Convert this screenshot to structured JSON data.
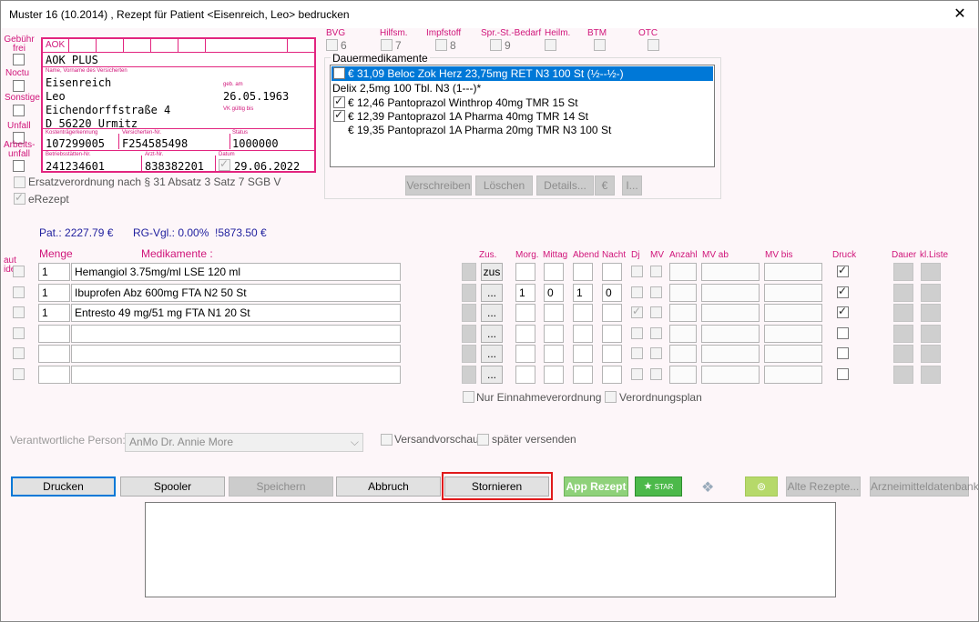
{
  "window": {
    "title": "Muster 16 (10.2014) , Rezept für Patient <Eisenreich, Leo> bedrucken"
  },
  "flags": {
    "gebuehr": "Gebühr frei",
    "noctu": "Noctu",
    "sonstige": "Sonstige",
    "unfall": "Unfall",
    "arbeitsunfall": "Arbeits-unfall",
    "aut_idem": "aut idem"
  },
  "form": {
    "kasse": "AOK",
    "kasse_name": "AOK PLUS",
    "label_name": "Name, Vorname des Versicherten",
    "lastname": "Eisenreich",
    "firstname": "Leo",
    "street": "Eichendorffstraße 4",
    "city": "D 56220 Urmitz",
    "label_geb": "geb. am",
    "birthdate": "26.05.1963",
    "label_vk": "VK gültig bis",
    "label_kt": "Kostenträgerkennung",
    "kt": "107299005",
    "label_vers": "Versicherten-Nr.",
    "vers": "F254585498",
    "label_status": "Status",
    "status": "1000000",
    "label_bs": "Betriebsstätten-Nr.",
    "bs": "241234601",
    "label_arzt": "Arzt-Nr.",
    "arzt": "838382201",
    "label_datum": "Datum",
    "datum": "29.06.2022"
  },
  "categories": [
    {
      "label": "BVG",
      "num": "6"
    },
    {
      "label": "Hilfsm.",
      "num": "7"
    },
    {
      "label": "Impfstoff",
      "num": "8"
    },
    {
      "label": "Spr.-St.-Bedarf",
      "num": "9"
    },
    {
      "label": "Heilm.",
      "num": ""
    },
    {
      "label": "BTM",
      "num": ""
    },
    {
      "label": "OTC",
      "num": ""
    }
  ],
  "ersatz": "Ersatzverordnung nach § 31 Absatz 3 Satz 7 SGB V",
  "erezept": "eRezept",
  "dauer": {
    "title": "Dauermedikamente",
    "items": [
      {
        "text": "€ 31,09   Beloc Zok Herz 23,75mg RET N3 100 St (½--½-)",
        "checked": false,
        "selected": true
      },
      {
        "text": "Delix 2,5mg 100 Tbl.  N3 (1---)*",
        "checked": false,
        "selected": false
      },
      {
        "text": "€ 12,46  Pantoprazol Winthrop 40mg TMR 15 St",
        "checked": true,
        "selected": false
      },
      {
        "text": "€ 12,39  Pantoprazol 1A Pharma 40mg TMR 14 St",
        "checked": true,
        "selected": false
      },
      {
        "text": "€ 19,35   Pantoprazol 1A Pharma 20mg TMR N3 100 St",
        "checked": false,
        "selected": false
      }
    ],
    "buttons": {
      "verschreiben": "Verschreiben",
      "loeschen": "Löschen",
      "details": "Details...",
      "euro": "€",
      "i": "I..."
    }
  },
  "summary": {
    "pat": "Pat.:  2227.79 €",
    "rg": "RG-Vgl.:  0.00%",
    "rg2": "!5873.50 €"
  },
  "table": {
    "h_menge": "Menge",
    "h_med": "Medikamente :",
    "h_zus": "Zus.",
    "h_morg": "Morg.",
    "h_mittag": "Mittag",
    "h_abend": "Abend",
    "h_nacht": "Nacht",
    "h_dj": "Dj",
    "h_mv": "MV",
    "h_anzahl": "Anzahl",
    "h_mvab": "MV ab",
    "h_mvbis": "MV bis",
    "h_druck": "Druck",
    "h_dauer": "Dauer",
    "h_klliste": "kl.Liste",
    "rows": [
      {
        "menge": "1",
        "med": "Hemangiol 3.75mg/ml LSE 120 ml",
        "zus": "zus",
        "morg": "",
        "mittag": "",
        "abend": "",
        "nacht": "",
        "dj": false,
        "druck": true
      },
      {
        "menge": "1",
        "med": "Ibuprofen Abz 600mg FTA N2 50 St",
        "zus": "...",
        "morg": "1",
        "mittag": "0",
        "abend": "1",
        "nacht": "0",
        "dj": false,
        "druck": true
      },
      {
        "menge": "1",
        "med": "Entresto 49 mg/51 mg FTA N1 20 St",
        "zus": "...",
        "morg": "",
        "mittag": "",
        "abend": "",
        "nacht": "",
        "dj": true,
        "druck": true
      },
      {
        "menge": "",
        "med": "",
        "zus": "...",
        "morg": "",
        "mittag": "",
        "abend": "",
        "nacht": "",
        "dj": false,
        "druck": false
      },
      {
        "menge": "",
        "med": "",
        "zus": "...",
        "morg": "",
        "mittag": "",
        "abend": "",
        "nacht": "",
        "dj": false,
        "druck": false
      },
      {
        "menge": "",
        "med": "",
        "zus": "...",
        "morg": "",
        "mittag": "",
        "abend": "",
        "nacht": "",
        "dj": false,
        "druck": false
      }
    ]
  },
  "options": {
    "nur": "Nur Einnahmeverordnung",
    "plan": "Verordnungsplan"
  },
  "person": {
    "label": "Verantwortliche Person:",
    "value": "AnMo   Dr. Annie More"
  },
  "versand": {
    "vorschau": "Versandvorschau",
    "spaeter": "später versenden"
  },
  "actions": {
    "drucken": "Drucken",
    "spooler": "Spooler",
    "speichern": "Speichern",
    "abbruch": "Abbruch",
    "stornieren": "Stornieren",
    "app": "App Rezept",
    "star": "STAR",
    "alte": "Alte Rezepte...",
    "arznei": "Arzneimitteldatenbank"
  }
}
